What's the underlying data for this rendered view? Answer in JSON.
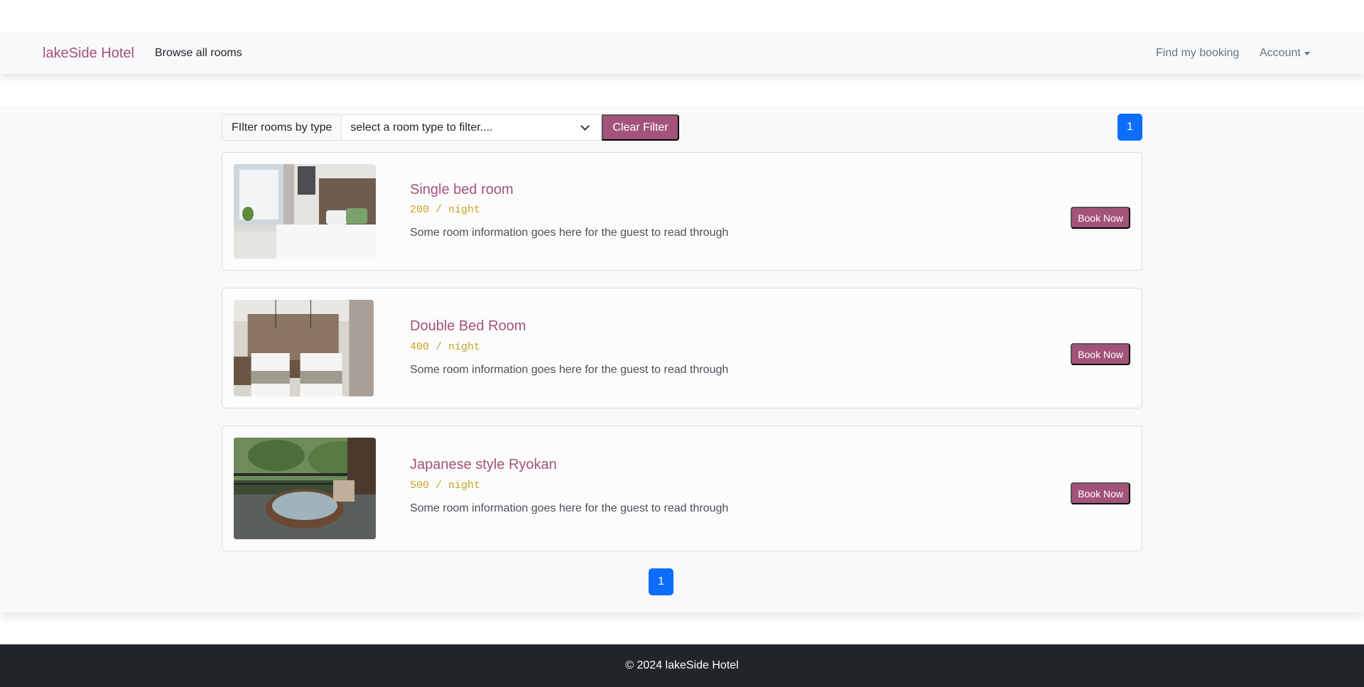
{
  "nav": {
    "brand": "lakeSide Hotel",
    "browse": "Browse all rooms",
    "find_booking": "Find my booking",
    "account": "Account"
  },
  "filter": {
    "label": "FIlter rooms by type",
    "placeholder": "select a room type to filter....",
    "clear_label": "Clear Filter"
  },
  "pagination": {
    "top_page": "1",
    "bottom_page": "1"
  },
  "rooms": [
    {
      "name": "Single bed room",
      "price": "200 / night",
      "description": "Some room information goes here for the guest to read through",
      "book_label": "Book Now"
    },
    {
      "name": "Double Bed Room",
      "price": "400 / night",
      "description": "Some room information goes here for the guest to read through",
      "book_label": "Book Now"
    },
    {
      "name": "Japanese style Ryokan",
      "price": "500 / night",
      "description": "Some room information goes here for the guest to read through",
      "book_label": "Book Now"
    }
  ],
  "footer": {
    "copyright": "© 2024 lakeSide Hotel"
  },
  "colors": {
    "accent": "#a35379",
    "price": "#c9a227",
    "page_active": "#0d6efd",
    "footer_bg": "#212529"
  }
}
